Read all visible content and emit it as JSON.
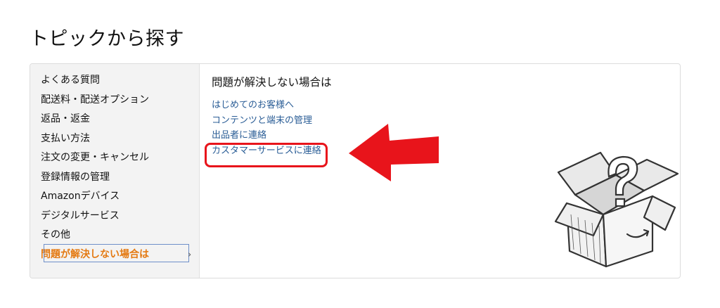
{
  "page": {
    "title": "トピックから探す"
  },
  "sidebar": {
    "items": [
      {
        "label": "よくある質問"
      },
      {
        "label": "配送料・配送オプション"
      },
      {
        "label": "返品・返金"
      },
      {
        "label": "支払い方法"
      },
      {
        "label": "注文の変更・キャンセル"
      },
      {
        "label": "登録情報の管理"
      },
      {
        "label": "Amazonデバイス"
      },
      {
        "label": "デジタルサービス"
      },
      {
        "label": "その他"
      },
      {
        "label": "問題が解決しない場合は"
      }
    ],
    "active_index": 9
  },
  "content": {
    "heading": "問題が解決しない場合は",
    "links": [
      {
        "label": "はじめてのお客様へ"
      },
      {
        "label": "コンテンツと端末の管理"
      },
      {
        "label": "出品者に連絡"
      },
      {
        "label": "カスタマーサービスに連絡"
      }
    ]
  },
  "annotation": {
    "color": "#e8141b",
    "highlighted_link_index": 3
  },
  "colors": {
    "accent": "#e47911",
    "link": "#2a5d96",
    "sidebar_bg": "#f3f3f3"
  },
  "icons": {
    "chevron": "chevron-right-icon",
    "illustration": "question-box-icon"
  }
}
